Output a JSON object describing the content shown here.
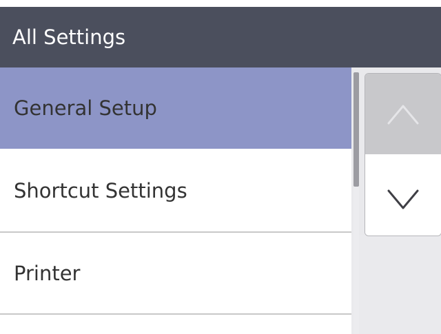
{
  "header": {
    "title": "All Settings"
  },
  "list": {
    "items": [
      {
        "label": "General Setup",
        "selected": true
      },
      {
        "label": "Shortcut Settings",
        "selected": false
      },
      {
        "label": "Printer",
        "selected": false
      }
    ]
  },
  "scroll": {
    "up_icon": "chevron-up-icon",
    "down_icon": "chevron-down-icon",
    "up_enabled": false,
    "down_enabled": true
  },
  "colors": {
    "header_bg": "#4b4f5d",
    "selected_bg": "#8d95c7",
    "text": "#333333"
  }
}
